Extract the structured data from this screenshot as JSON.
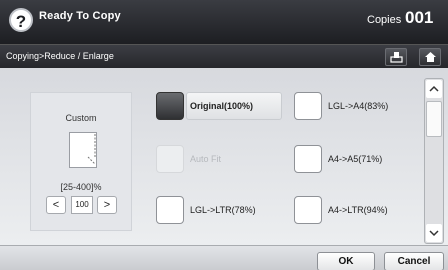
{
  "header": {
    "help_label": "?",
    "title": "Ready To Copy",
    "copies_label": "Copies",
    "copies_count": "001"
  },
  "path": {
    "breadcrumb": "Copying>Reduce / Enlarge"
  },
  "custom": {
    "title": "Custom",
    "range": "[25-400]%",
    "value": "100",
    "decrease": "<",
    "increase": ">"
  },
  "options": [
    {
      "label": "Original(100%)",
      "state": "selected"
    },
    {
      "label": "Auto Fit",
      "state": "disabled"
    },
    {
      "label": "LGL->LTR(78%)",
      "state": "normal"
    },
    {
      "label": "LGL->A4(83%)",
      "state": "normal"
    },
    {
      "label": "A4->A5(71%)",
      "state": "normal"
    },
    {
      "label": "A4->LTR(94%)",
      "state": "normal"
    }
  ],
  "footer": {
    "ok_label": "OK",
    "cancel_label": "Cancel"
  },
  "icons": [
    "help-icon",
    "job-status-icon",
    "home-icon",
    "page-icon",
    "scroll-up-icon",
    "scroll-down-icon"
  ]
}
